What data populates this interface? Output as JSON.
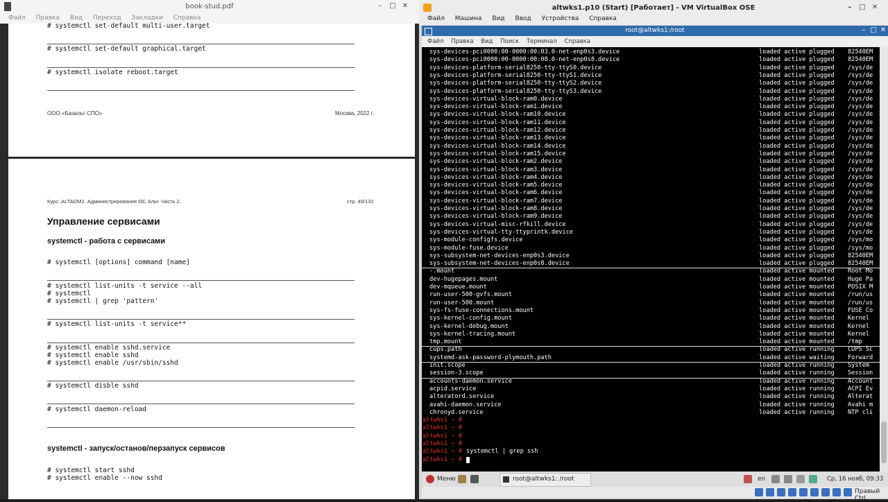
{
  "pdf": {
    "title": "book-stud.pdf",
    "menu": [
      "Файл",
      "Правка",
      "Вид",
      "Переход",
      "Закладки",
      "Справка"
    ],
    "page1": {
      "code_blocks": [
        "# systemctl set-default multi-user.target",
        "# systemctl set-default graphical.target",
        "# systemctl isolate reboot.target"
      ],
      "footer_left": "ООО «Базальт СПО»",
      "footer_right": "Москва, 2022 г."
    },
    "page2": {
      "header_left": "Курс: ALTADM2. Администрирование ОС Альт. Часть 2.",
      "header_right": "стр. 49/132",
      "heading": "Управление сервисами",
      "subheading1": "systemctl - работа с сервисами",
      "code1": "# systemctl [options] command [name]",
      "code2": "# systemctl list-units -t service --all\n# systemctl\n# systemctl | grep 'pattern'",
      "code3": "# systemctl list-units -t service**",
      "code4": "# systemctl enable sshd.service\n# systemctl enable sshd\n# systemctl enable /usr/sbin/sshd",
      "code5": "# systemctl disble sshd",
      "code6": "# systemctl daemon-reload",
      "subheading2": "systemctl - запуск/останов/перзапуск сервисов",
      "code7": "# systemctl start sshd\n# systemctl enable --now sshd"
    }
  },
  "vm": {
    "title": "altwks1.p10 (Start) [Работает] - VM VirtualBox OSE",
    "menu": [
      "Файл",
      "Машина",
      "Вид",
      "Ввод",
      "Устройства",
      "Справка"
    ],
    "terminal_title": "root@altwks1:/root",
    "terminal_menu": [
      "Файл",
      "Правка",
      "Вид",
      "Поиск",
      "Терминал",
      "Справка"
    ],
    "units": [
      {
        "u": "sys-devices-pci0000:00-0000:00:03.0-net-enp0s3.device",
        "s": "loaded active plugged",
        "d": "82540EM"
      },
      {
        "u": "sys-devices-pci0000:00-0000:00:08.0-net-enp0s8.device",
        "s": "loaded active plugged",
        "d": "82540EM"
      },
      {
        "u": "sys-devices-platform-serial8250-tty-ttyS0.device",
        "s": "loaded active plugged",
        "d": "/sys/de"
      },
      {
        "u": "sys-devices-platform-serial8250-tty-ttyS1.device",
        "s": "loaded active plugged",
        "d": "/sys/de"
      },
      {
        "u": "sys-devices-platform-serial8250-tty-ttyS2.device",
        "s": "loaded active plugged",
        "d": "/sys/de"
      },
      {
        "u": "sys-devices-platform-serial8250-tty-ttyS3.device",
        "s": "loaded active plugged",
        "d": "/sys/de"
      },
      {
        "u": "sys-devices-virtual-block-ram0.device",
        "s": "loaded active plugged",
        "d": "/sys/de"
      },
      {
        "u": "sys-devices-virtual-block-ram1.device",
        "s": "loaded active plugged",
        "d": "/sys/de"
      },
      {
        "u": "sys-devices-virtual-block-ram10.device",
        "s": "loaded active plugged",
        "d": "/sys/de"
      },
      {
        "u": "sys-devices-virtual-block-ram11.device",
        "s": "loaded active plugged",
        "d": "/sys/de"
      },
      {
        "u": "sys-devices-virtual-block-ram12.device",
        "s": "loaded active plugged",
        "d": "/sys/de"
      },
      {
        "u": "sys-devices-virtual-block-ram13.device",
        "s": "loaded active plugged",
        "d": "/sys/de"
      },
      {
        "u": "sys-devices-virtual-block-ram14.device",
        "s": "loaded active plugged",
        "d": "/sys/de"
      },
      {
        "u": "sys-devices-virtual-block-ram15.device",
        "s": "loaded active plugged",
        "d": "/sys/de"
      },
      {
        "u": "sys-devices-virtual-block-ram2.device",
        "s": "loaded active plugged",
        "d": "/sys/de"
      },
      {
        "u": "sys-devices-virtual-block-ram3.device",
        "s": "loaded active plugged",
        "d": "/sys/de"
      },
      {
        "u": "sys-devices-virtual-block-ram4.device",
        "s": "loaded active plugged",
        "d": "/sys/de"
      },
      {
        "u": "sys-devices-virtual-block-ram5.device",
        "s": "loaded active plugged",
        "d": "/sys/de"
      },
      {
        "u": "sys-devices-virtual-block-ram6.device",
        "s": "loaded active plugged",
        "d": "/sys/de"
      },
      {
        "u": "sys-devices-virtual-block-ram7.device",
        "s": "loaded active plugged",
        "d": "/sys/de"
      },
      {
        "u": "sys-devices-virtual-block-ram8.device",
        "s": "loaded active plugged",
        "d": "/sys/de"
      },
      {
        "u": "sys-devices-virtual-block-ram9.device",
        "s": "loaded active plugged",
        "d": "/sys/de"
      },
      {
        "u": "sys-devices-virtual-misc-rfkill.device",
        "s": "loaded active plugged",
        "d": "/sys/de"
      },
      {
        "u": "sys-devices-virtual-tty-ttyprintk.device",
        "s": "loaded active plugged",
        "d": "/sys/de"
      },
      {
        "u": "sys-module-configfs.device",
        "s": "loaded active plugged",
        "d": "/sys/mo"
      },
      {
        "u": "sys-module-fuse.device",
        "s": "loaded active plugged",
        "d": "/sys/mo"
      },
      {
        "u": "sys-subsystem-net-devices-enp0s3.device",
        "s": "loaded active plugged",
        "d": "82540EM"
      },
      {
        "u": "sys-subsystem-net-devices-enp0s8.device",
        "s": "loaded active plugged",
        "d": "82540EM",
        "sep": true
      },
      {
        "u": "-.mount",
        "s": "loaded active mounted",
        "d": "Root Mo"
      },
      {
        "u": "dev-hugepages.mount",
        "s": "loaded active mounted",
        "d": "Huge Pa"
      },
      {
        "u": "dev-mqueue.mount",
        "s": "loaded active mounted",
        "d": "POSIX M"
      },
      {
        "u": "run-user-500-gvfs.mount",
        "s": "loaded active mounted",
        "d": "/run/us"
      },
      {
        "u": "run-user-500.mount",
        "s": "loaded active mounted",
        "d": "/run/us"
      },
      {
        "u": "sys-fs-fuse-connections.mount",
        "s": "loaded active mounted",
        "d": "FUSE Co"
      },
      {
        "u": "sys-kernel-config.mount",
        "s": "loaded active mounted",
        "d": "Kernel"
      },
      {
        "u": "sys-kernel-debug.mount",
        "s": "loaded active mounted",
        "d": "Kernel"
      },
      {
        "u": "sys-kernel-tracing.mount",
        "s": "loaded active mounted",
        "d": "Kernel"
      },
      {
        "u": "tmp.mount",
        "s": "loaded active mounted",
        "d": "/tmp",
        "sep": true
      },
      {
        "u": "cups.path",
        "s": "loaded active running",
        "d": "CUPS Sc"
      },
      {
        "u": "systemd-ask-password-plymouth.path",
        "s": "loaded active waiting",
        "d": "Forward",
        "sep": true
      },
      {
        "u": "init.scope",
        "s": "loaded active running",
        "d": "System"
      },
      {
        "u": "session-3.scope",
        "s": "loaded active running",
        "d": "Session",
        "sep": true
      },
      {
        "u": "accounts-daemon.service",
        "s": "loaded active running",
        "d": "Account"
      },
      {
        "u": "acpid.service",
        "s": "loaded active running",
        "d": "ACPI Ev"
      },
      {
        "u": "alteratord.service",
        "s": "loaded active running",
        "d": "Alterat"
      },
      {
        "u": "avahi-daemon.service",
        "s": "loaded active running",
        "d": "Avahi m"
      },
      {
        "u": "chronyd.service",
        "s": "loaded active running",
        "d": "NTP cli"
      }
    ],
    "prompt": "altwks1 ~ #",
    "prompt_lines": [
      "",
      "",
      "",
      "",
      "systemctl | grep ssh",
      ""
    ],
    "taskbar": {
      "menu_label": "Меню",
      "task_label": "root@altwks1: /root",
      "lang": "en",
      "clock": "Ср, 16 нояб, 09:33"
    },
    "status_host_key": "Правый Ctrl"
  }
}
